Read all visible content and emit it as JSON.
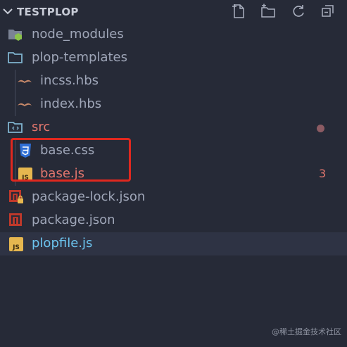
{
  "explorer": {
    "title": "TESTPLOP",
    "actions": [
      {
        "name": "new-file-icon"
      },
      {
        "name": "new-folder-icon"
      },
      {
        "name": "refresh-icon"
      },
      {
        "name": "collapse-all-icon"
      }
    ]
  },
  "tree": [
    {
      "label": "node_modules",
      "type": "folder",
      "icon": "node-modules-folder-icon",
      "color": "#9fa6b8"
    },
    {
      "label": "plop-templates",
      "type": "folder",
      "icon": "folder-icon",
      "color": "#9fa6b8"
    },
    {
      "label": "incss.hbs",
      "type": "file",
      "icon": "handlebars-icon",
      "color": "#9fa6b8"
    },
    {
      "label": "index.hbs",
      "type": "file",
      "icon": "handlebars-icon",
      "color": "#9fa6b8"
    },
    {
      "label": "src",
      "type": "folder",
      "icon": "src-folder-icon",
      "color": "#e2766d",
      "status": "modified-dot"
    },
    {
      "label": "base.css",
      "type": "file",
      "icon": "css-icon",
      "color": "#9fa6b8"
    },
    {
      "label": "base.js",
      "type": "file",
      "icon": "js-icon",
      "color": "#e2766d",
      "badge": "3"
    },
    {
      "label": "package-lock.json",
      "type": "file",
      "icon": "npm-lock-icon",
      "color": "#9fa6b8"
    },
    {
      "label": "package.json",
      "type": "file",
      "icon": "npm-icon",
      "color": "#9fa6b8"
    },
    {
      "label": "plopfile.js",
      "type": "file",
      "icon": "js-icon",
      "color": "#6cc4ef",
      "selected": true
    }
  ],
  "watermark": "@稀土掘金技术社区",
  "colors": {
    "background": "#262a37",
    "selected_row": "#2e3344",
    "highlight_box": "#e0281f",
    "error_text": "#e2766d",
    "muted_text": "#9fa6b8",
    "selected_text": "#6cc4ef"
  }
}
